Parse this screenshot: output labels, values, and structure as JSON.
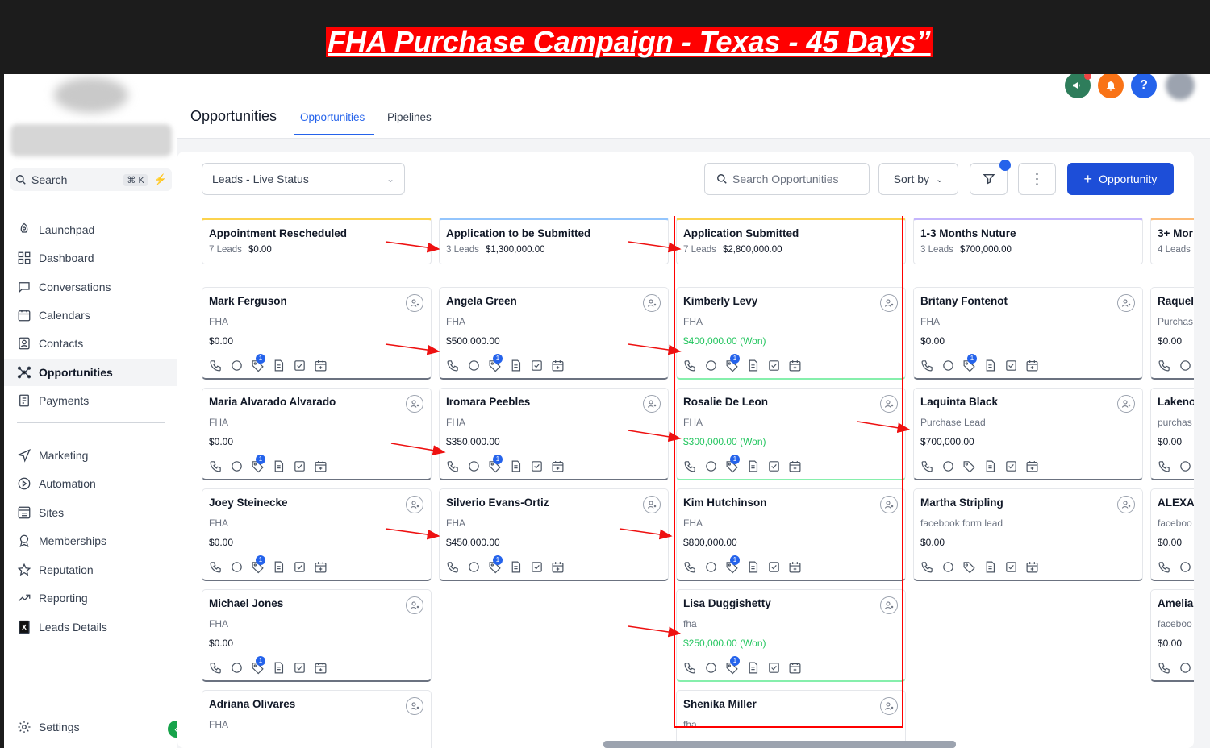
{
  "banner": {
    "title": "FHA Purchase Campaign - Texas - 45 Days”"
  },
  "sidebar": {
    "search_label": "Search",
    "search_shortcut": "⌘ K",
    "items": [
      {
        "label": "Launchpad",
        "icon": "rocket-icon"
      },
      {
        "label": "Dashboard",
        "icon": "grid-icon"
      },
      {
        "label": "Conversations",
        "icon": "chat-icon"
      },
      {
        "label": "Calendars",
        "icon": "calendar-icon"
      },
      {
        "label": "Contacts",
        "icon": "contacts-icon"
      },
      {
        "label": "Opportunities",
        "icon": "opportunities-icon"
      },
      {
        "label": "Payments",
        "icon": "payments-icon"
      },
      {
        "label": "Marketing",
        "icon": "send-icon"
      },
      {
        "label": "Automation",
        "icon": "automation-icon"
      },
      {
        "label": "Sites",
        "icon": "sites-icon"
      },
      {
        "label": "Memberships",
        "icon": "membership-icon"
      },
      {
        "label": "Reputation",
        "icon": "star-icon"
      },
      {
        "label": "Reporting",
        "icon": "chart-line-icon"
      },
      {
        "label": "Leads Details",
        "icon": "excel-icon"
      }
    ],
    "settings_label": "Settings"
  },
  "header": {
    "title": "Opportunities",
    "tabs": [
      "Opportunities",
      "Pipelines"
    ],
    "colors": {
      "megaphone": "#2e7d5b",
      "bell": "#f97316",
      "help": "#2563eb",
      "megaphone_dot": "#ef4444"
    },
    "help_symbol": "?"
  },
  "toolbar": {
    "pipeline_select": "Leads - Live Status",
    "search_placeholder": "Search Opportunities",
    "sort_label": "Sort by",
    "add_label": "Opportunity"
  },
  "columns": [
    {
      "name": "Appointment Rescheduled",
      "leads": "7 Leads",
      "total": "$0.00",
      "accent": "#fcd34d",
      "cards": [
        {
          "name": "Mark Ferguson",
          "source": "FHA",
          "value": "$0.00",
          "won": false,
          "badge": "1"
        },
        {
          "name": "Maria Alvarado Alvarado",
          "source": "FHA",
          "value": "$0.00",
          "won": false,
          "badge": "1"
        },
        {
          "name": "Joey Steinecke",
          "source": "FHA",
          "value": "$0.00",
          "won": false,
          "badge": "1"
        },
        {
          "name": "Michael Jones",
          "source": "FHA",
          "value": "$0.00",
          "won": false,
          "badge": "1"
        },
        {
          "name": "Adriana Olivares",
          "source": "FHA",
          "value": "",
          "won": false,
          "badge": ""
        }
      ]
    },
    {
      "name": "Application to be Submitted",
      "leads": "3 Leads",
      "total": "$1,300,000.00",
      "accent": "#93c5fd",
      "cards": [
        {
          "name": "Angela Green",
          "source": "FHA",
          "value": "$500,000.00",
          "won": false,
          "badge": "1"
        },
        {
          "name": "Iromara Peebles",
          "source": "FHA",
          "value": "$350,000.00",
          "won": false,
          "badge": "1"
        },
        {
          "name": "Silverio Evans-Ortiz",
          "source": "FHA",
          "value": "$450,000.00",
          "won": false,
          "badge": "1"
        }
      ]
    },
    {
      "name": "Application Submitted",
      "leads": "7 Leads",
      "total": "$2,800,000.00",
      "accent": "#fcd34d",
      "cards": [
        {
          "name": "Kimberly Levy",
          "source": "FHA",
          "value": "$400,000.00 (Won)",
          "won": true,
          "badge": "1"
        },
        {
          "name": "Rosalie De Leon",
          "source": "FHA",
          "value": "$300,000.00 (Won)",
          "won": true,
          "badge": "1"
        },
        {
          "name": "Kim Hutchinson",
          "source": "FHA",
          "value": "$800,000.00",
          "won": false,
          "badge": "1"
        },
        {
          "name": "Lisa Duggishetty",
          "source": "fha",
          "value": "$250,000.00 (Won)",
          "won": true,
          "badge": "1"
        },
        {
          "name": "Shenika Miller",
          "source": "fha",
          "value": "",
          "won": false,
          "badge": ""
        }
      ]
    },
    {
      "name": "1-3 Months Nuture",
      "leads": "3 Leads",
      "total": "$700,000.00",
      "accent": "#c4b5fd",
      "cards": [
        {
          "name": "Britany Fontenot",
          "source": "FHA",
          "value": "$0.00",
          "won": false,
          "badge": "1"
        },
        {
          "name": "Laquinta Black",
          "source": "Purchase Lead",
          "value": "$700,000.00",
          "won": false,
          "badge": ""
        },
        {
          "name": "Martha Stripling",
          "source": "facebook form lead",
          "value": "$0.00",
          "won": false,
          "badge": ""
        }
      ]
    },
    {
      "name": "3+ Mor",
      "leads": "4 Leads",
      "total": "",
      "accent": "#fdba74",
      "cards": [
        {
          "name": "Raquel",
          "source": "Purchas",
          "value": "$0.00",
          "won": false,
          "badge": ""
        },
        {
          "name": "Lakeno",
          "source": "purchas",
          "value": "$0.00",
          "won": false,
          "badge": ""
        },
        {
          "name": "ALEXA",
          "source": "faceboo",
          "value": "$0.00",
          "won": false,
          "badge": ""
        },
        {
          "name": "Amelia",
          "source": "faceboo",
          "value": "$0.00",
          "won": false,
          "badge": ""
        }
      ]
    }
  ]
}
